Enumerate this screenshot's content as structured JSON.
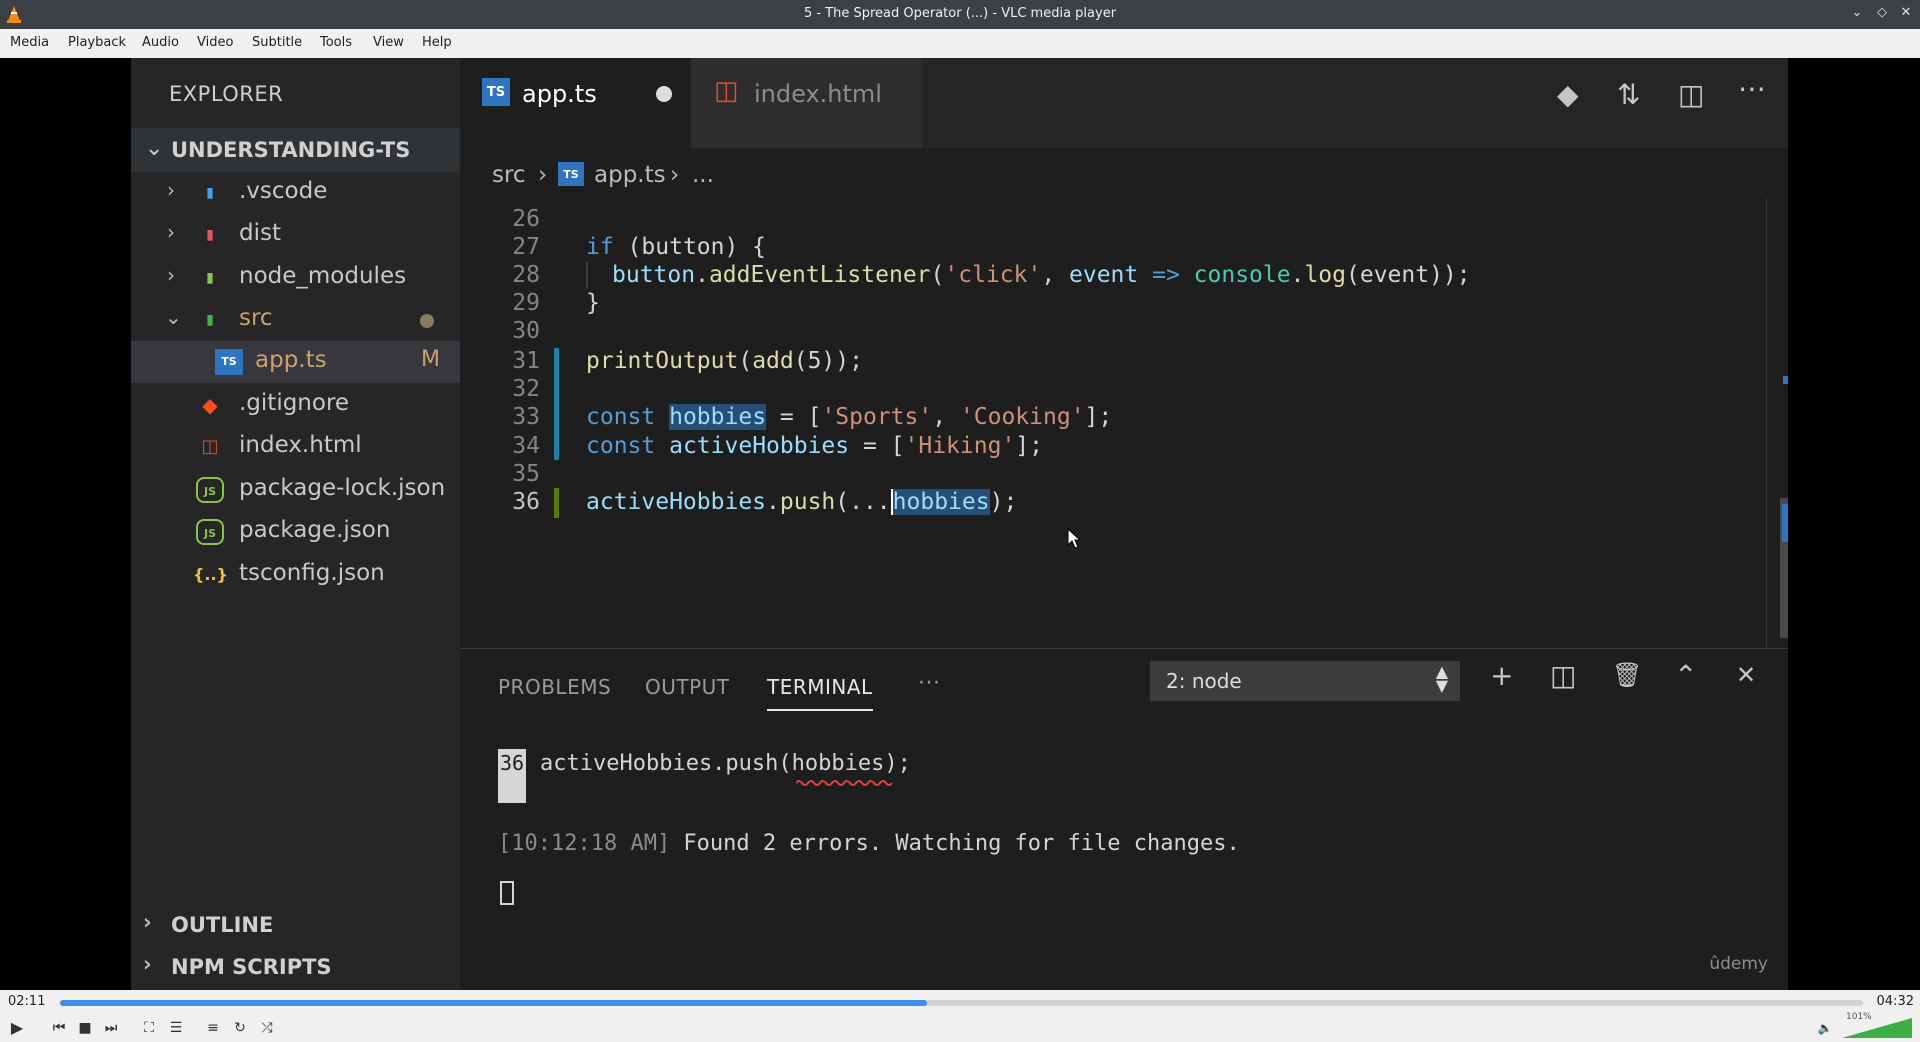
{
  "window": {
    "title": "5 - The Spread Operator (...) - VLC media player"
  },
  "menu": [
    "Media",
    "Playback",
    "Audio",
    "Video",
    "Subtitle",
    "Tools",
    "View",
    "Help"
  ],
  "explorer": {
    "header": "EXPLORER",
    "project": "UNDERSTANDING-TS",
    "items": [
      {
        "name": ".vscode"
      },
      {
        "name": "dist"
      },
      {
        "name": "node_modules"
      },
      {
        "name": "src"
      },
      {
        "name": "app.ts",
        "badge": "M"
      },
      {
        "name": ".gitignore"
      },
      {
        "name": "index.html"
      },
      {
        "name": "package-lock.json"
      },
      {
        "name": "package.json"
      },
      {
        "name": "tsconfig.json"
      }
    ],
    "icons": {
      "ts": "TS",
      "js": "JS",
      "json": "{..}"
    },
    "outline": "OUTLINE",
    "npm_scripts": "NPM SCRIPTS"
  },
  "tabs": [
    {
      "label": "app.ts",
      "icon": "TS"
    },
    {
      "label": "index.html"
    }
  ],
  "breadcrumb": {
    "folder": "src",
    "file": "app.ts",
    "more": "..."
  },
  "code": {
    "line_numbers": [
      "26",
      "27",
      "28",
      "29",
      "30",
      "31",
      "32",
      "33",
      "34",
      "35",
      "36"
    ],
    "l27": {
      "kw": "if",
      "rest": " (button) {"
    },
    "l28": {
      "obj": "button",
      "dot": ".",
      "fn": "addEventListener",
      "open": "(",
      "str": "'click'",
      "comma": ", ",
      "param": "event",
      "arrow": " => ",
      "console": "console",
      "dot2": ".",
      "log": "log",
      "args": "(event));"
    },
    "l29": "}",
    "l31": {
      "fn": "printOutput",
      "mid": "(",
      "fn2": "add",
      "args": "(5));"
    },
    "l33": {
      "kw": "const",
      "var": "hobbies",
      "eq": " = [",
      "s1": "'Sports'",
      "c": ", ",
      "s2": "'Cooking'",
      "end": "];"
    },
    "l34": {
      "kw": "const",
      "var": "activeHobbies",
      "eq": " = [",
      "s1": "'Hiking'",
      "end": "];"
    },
    "l36": {
      "obj": "activeHobbies",
      "dot": ".",
      "fn": "push",
      "open": "(...",
      "sel": "hobbies",
      "end": ");"
    }
  },
  "panel": {
    "tabs": [
      "PROBLEMS",
      "OUTPUT",
      "TERMINAL"
    ],
    "more": "···",
    "terminal_select": "2: node",
    "error_line_no": "36",
    "error_code": "activeHobbies.push(hobbies);",
    "status_time": "[10:12:18 AM]",
    "status_msg": " Found 2 errors. Watching for file changes.",
    "watermark": "ûdemy"
  },
  "player": {
    "elapsed": "02:11",
    "total": "04:32",
    "progress": 0.481,
    "volume_label": "101%",
    "volume": 1.01
  }
}
